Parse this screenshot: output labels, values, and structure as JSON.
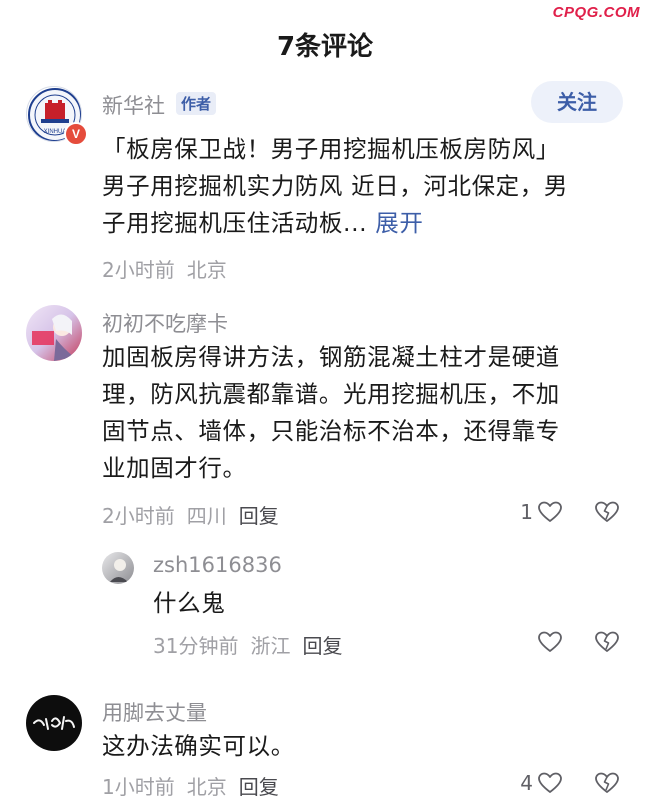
{
  "watermark": "CPQG.COM",
  "header": {
    "title": "7条评论"
  },
  "post": {
    "username": "新华社",
    "author_tag": "作者",
    "follow_label": "关注",
    "avatar_badge": "V",
    "avatar_icon": "xinhua-logo",
    "lines": [
      "「板房保卫战！男子用挖掘机压板房防风」",
      "男子用挖掘机实力防风 近日，河北保定，男",
      "子用挖掘机压住活动板..."
    ],
    "expand_label": "展开",
    "time": "2小时前",
    "location": "北京"
  },
  "comments": [
    {
      "username": "初初不吃摩卡",
      "lines": [
        "加固板房得讲方法，钢筋混凝土柱才是硬道",
        "理，防风抗震都靠谱。光用挖掘机压，不加",
        "固节点、墙体，只能治标不治本，还得靠专",
        "业加固才行。"
      ],
      "time": "2小时前",
      "location": "四川",
      "reply_label": "回复",
      "likes": "1",
      "replies": [
        {
          "username": "zsh1616836",
          "text": "什么鬼",
          "time": "31分钟前",
          "location": "浙江",
          "reply_label": "回复",
          "likes": ""
        }
      ]
    },
    {
      "username": "用脚去丈量",
      "lines": [
        "这办法确实可以。"
      ],
      "time": "1小时前",
      "location": "北京",
      "reply_label": "回复",
      "likes": "4"
    }
  ],
  "icons": {
    "like": "heart-outline-icon",
    "dislike": "broken-heart-icon"
  },
  "colors": {
    "accent": "#3d5ea8",
    "watermark": "#e0204a",
    "meta": "#a0a0a5"
  }
}
